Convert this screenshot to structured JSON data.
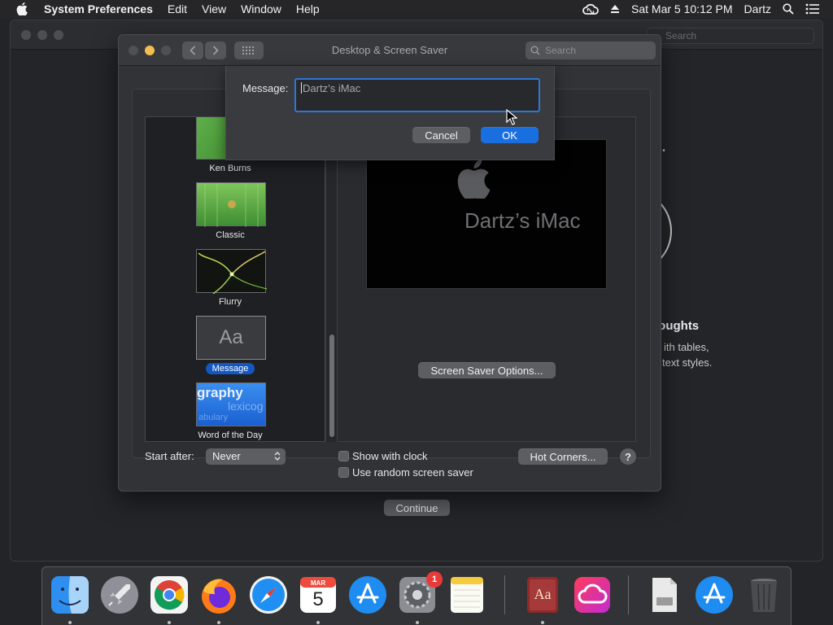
{
  "menubar": {
    "app": "System Preferences",
    "items": [
      "Edit",
      "View",
      "Window",
      "Help"
    ],
    "clock": "Sat Mar 5  10:12 PM",
    "user": "Dartz"
  },
  "background_window": {
    "search_placeholder": "Search",
    "partial_text_1": "t.",
    "partial_heading": "houghts",
    "partial_text_2": "ith tables,",
    "partial_text_3": "text styles.",
    "continue_label": "Continue"
  },
  "prefs_window": {
    "title": "Desktop & Screen Saver",
    "search_placeholder": "Search",
    "savers": [
      {
        "name": "Ken Burns",
        "selected": false
      },
      {
        "name": "Classic",
        "selected": false
      },
      {
        "name": "Flurry",
        "selected": false
      },
      {
        "name": "Message",
        "selected": true
      },
      {
        "name": "Word of the Day",
        "selected": false
      }
    ],
    "message_thumb_text": "Aa",
    "word_thumb_text": "graphy",
    "word_thumb_sub": "lexicog",
    "word_thumb_sub2": "abulary",
    "preview_message": "Dartz’s iMac",
    "options_button": "Screen Saver Options...",
    "start_after_label": "Start after:",
    "start_after_value": "Never",
    "show_clock_label": "Show with clock",
    "random_label": "Use random screen saver",
    "hot_corners_button": "Hot Corners...",
    "help_label": "?"
  },
  "sheet": {
    "message_label": "Message:",
    "message_value": "Dartz’s iMac",
    "cancel_label": "Cancel",
    "ok_label": "OK"
  },
  "dock": {
    "system_prefs_badge": "1",
    "calendar_month": "MAR",
    "calendar_day": "5",
    "dictionary_glyph": "Aa"
  },
  "colors": {
    "accent": "#1a6fe0",
    "focus_ring": "#2e77d6",
    "badge": "#e93a3a"
  }
}
